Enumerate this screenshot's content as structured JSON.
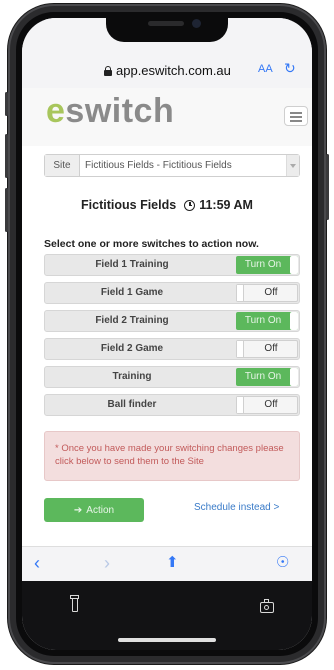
{
  "browser": {
    "url": "app.eswitch.com.au",
    "text_size": "AA",
    "reload_icon": "reload-icon"
  },
  "header": {
    "logo_e": "e",
    "logo_rest": "switch"
  },
  "site_select": {
    "label": "Site",
    "value": "Fictitious Fields - Fictitious Fields"
  },
  "title": {
    "site_name": "Fictitious Fields",
    "time": "11:59 AM"
  },
  "instructions": "Select one or more switches to action now.",
  "switches": [
    {
      "name": "Field 1 Training",
      "state": "Turn On"
    },
    {
      "name": "Field 1 Game",
      "state": "Off"
    },
    {
      "name": "Field 2 Training",
      "state": "Turn On"
    },
    {
      "name": "Field 2 Game",
      "state": "Off"
    },
    {
      "name": "Training",
      "state": "Turn On"
    },
    {
      "name": "Ball finder",
      "state": "Off"
    }
  ],
  "notice": "* Once you have made your switching changes please click below to send them to the Site",
  "action_button": "Action",
  "schedule_link": "Schedule instead >",
  "colors": {
    "accent_green": "#5cb85c",
    "logo_green": "#a8c65c",
    "link_blue": "#3a7bc8",
    "notice_bg": "#f3dede"
  }
}
